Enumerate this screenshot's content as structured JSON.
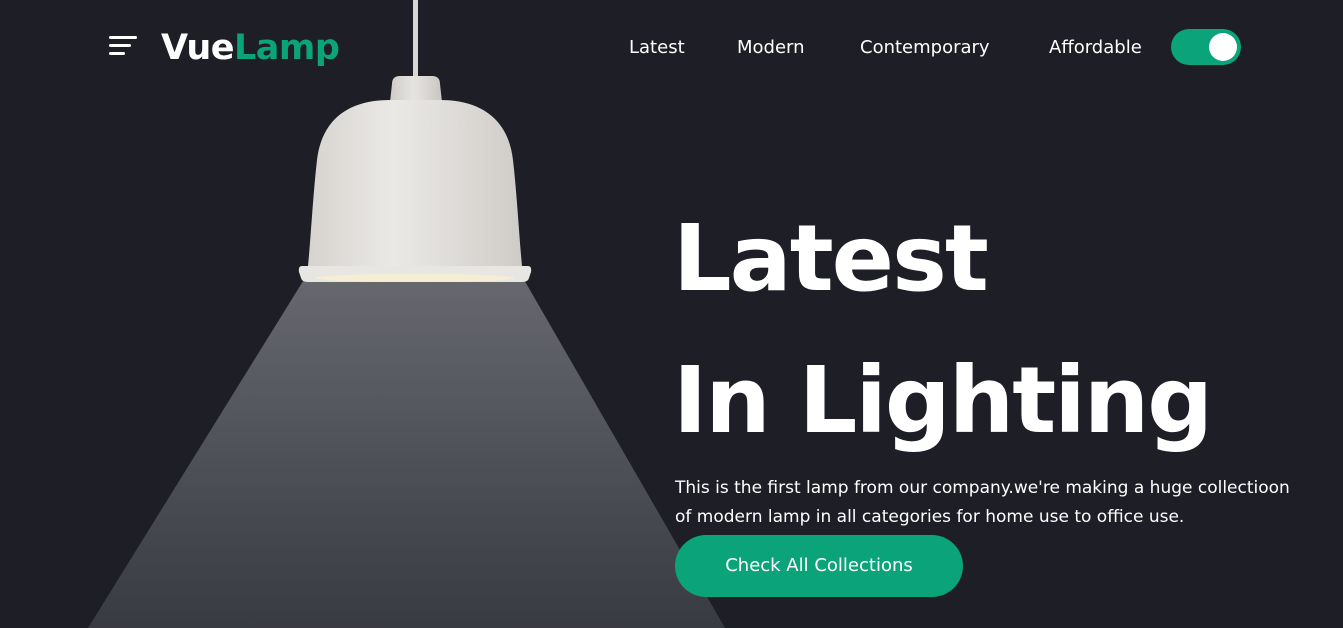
{
  "brand": {
    "part1": "Vue",
    "part2": "Lamp",
    "accent_color": "#0aa37a"
  },
  "header": {
    "menu_icon": "hamburger-menu-icon",
    "nav": [
      {
        "label": "Latest"
      },
      {
        "label": "Modern"
      },
      {
        "label": "Contemporary"
      },
      {
        "label": "Affordable"
      }
    ],
    "toggle": {
      "state": "on"
    }
  },
  "hero": {
    "title_line1": "Latest",
    "title_line2": "In Lighting",
    "description_line1": "This is the first lamp from our company.we're making a huge collectioon",
    "description_line2": "of modern lamp in all categories for home use to office use.",
    "cta_label": "Check All Collections"
  },
  "colors": {
    "background": "#1e1f26",
    "text": "#ffffff",
    "lamp_shade": "#e4e2df"
  }
}
